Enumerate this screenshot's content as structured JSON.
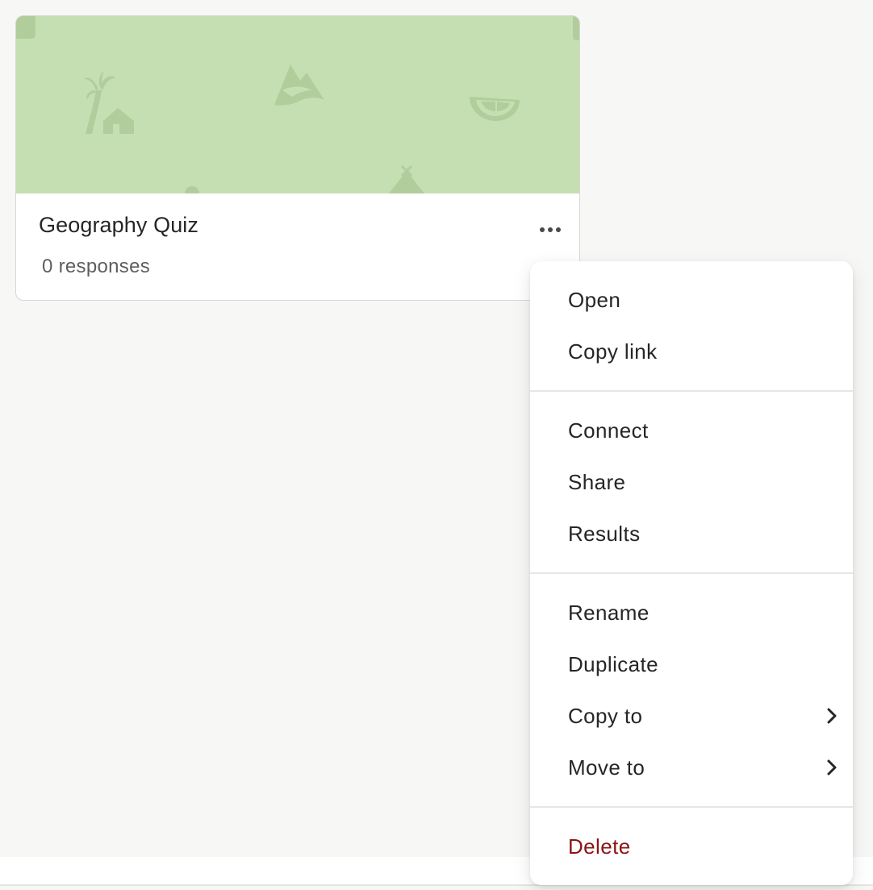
{
  "card": {
    "title": "Geography Quiz",
    "meta": "0 responses",
    "thumbnail_color": "#c5dfb2",
    "more_icon": "ellipsis-icon"
  },
  "menu": {
    "open": "Open",
    "copy_link": "Copy link",
    "connect": "Connect",
    "share": "Share",
    "results": "Results",
    "rename": "Rename",
    "duplicate": "Duplicate",
    "copy_to": "Copy to",
    "move_to": "Move to",
    "delete": "Delete",
    "submenu_icon": "chevron-right-icon",
    "danger_color": "#8c1515"
  }
}
